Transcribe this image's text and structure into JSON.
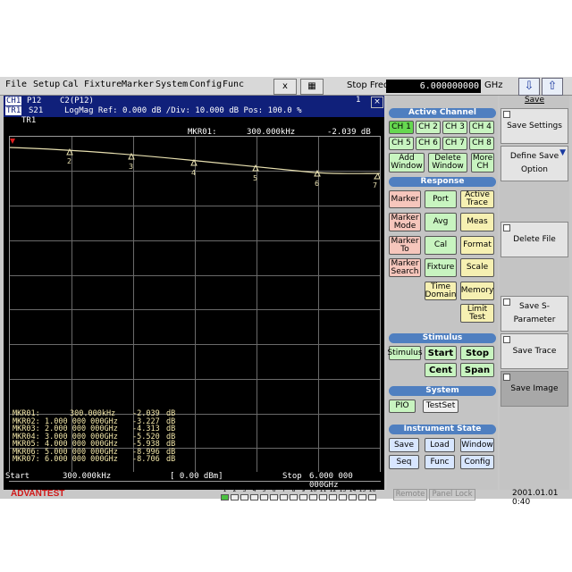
{
  "menu": [
    "File",
    "Setup",
    "Cal",
    "Fixture",
    "Marker",
    "System",
    "Config",
    "Func"
  ],
  "toolbar": {
    "x_btn": "x",
    "stop_freq_label": "Stop Freq",
    "stop_freq_value": "6.000000000",
    "stop_freq_unit": "GHz"
  },
  "screen": {
    "ch_label": "CH1",
    "p12": "P12",
    "c2": "C2(P12)",
    "tr_label": "TR1",
    "s21": "S21",
    "params": "LogMag  Ref: 0.000 dB  /Div: 10.000 dB  Pos: 100.0 %",
    "trace_tab": "TR1",
    "window_num": "1",
    "close": "×",
    "active_marker_label": "MKR01:",
    "active_marker_freq": "300.000kHz",
    "active_marker_val": "-2.039 dB"
  },
  "markers": [
    {
      "label": "MKR01:",
      "freq": "300.000kHz",
      "val": "-2.039",
      "unit": "dB"
    },
    {
      "label": "MKR02:",
      "freq": "1.000 000 000GHz",
      "val": "-3.227",
      "unit": "dB"
    },
    {
      "label": "MKR03:",
      "freq": "2.000 000 000GHz",
      "val": "-4.313",
      "unit": "dB"
    },
    {
      "label": "MKR04:",
      "freq": "3.000 000 000GHz",
      "val": "-5.520",
      "unit": "dB"
    },
    {
      "label": "MKR05:",
      "freq": "4.000 000 000GHz",
      "val": "-5.938",
      "unit": "dB"
    },
    {
      "label": "MKR06:",
      "freq": "5.000 000 000GHz",
      "val": "-8.996",
      "unit": "dB"
    },
    {
      "label": "MKR07:",
      "freq": "6.000 000 000GHz",
      "val": "-8.706",
      "unit": "dB"
    }
  ],
  "marker_numbers": [
    "2",
    "3",
    "4",
    "5",
    "6",
    "7"
  ],
  "statusbar": {
    "start_label": "Start",
    "start_val": "300.000kHz",
    "power": "[ 0.00 dBm]",
    "stop_label": "Stop",
    "stop_val": "6.000 000 000GHz"
  },
  "panel": {
    "active_channel": "Active Channel",
    "channels": [
      "CH 1",
      "CH 2",
      "CH 3",
      "CH 4",
      "CH 5",
      "CH 6",
      "CH 7",
      "CH 8"
    ],
    "add_window": "Add Window",
    "delete_window": "Delete Window",
    "more_ch": "More CH",
    "response": "Response",
    "marker": "Marker",
    "port": "Port",
    "active_trace": "Active Trace",
    "marker_mode": "Marker Mode",
    "avg": "Avg",
    "meas": "Meas",
    "marker_to": "Marker To",
    "cal": "Cal",
    "format": "Format",
    "marker_search": "Marker Search",
    "fixture": "Fixture",
    "scale": "Scale",
    "time_domain": "Time Domain",
    "memory": "Memory",
    "limit_test": "Limit Test",
    "stimulus": "Stimulus",
    "stimulus_btn": "Stimulus",
    "start": "Start",
    "stop": "Stop",
    "cent": "Cent",
    "span": "Span",
    "system": "System",
    "pio": "PIO",
    "testset": "TestSet",
    "instrument_state": "Instrument State",
    "save": "Save",
    "load": "Load",
    "window": "Window",
    "seq": "Seq",
    "func": "Func",
    "config": "Config"
  },
  "softkeys": {
    "title": "Save",
    "save_settings": "Save Settings",
    "define_save_option": "Define Save Option",
    "delete_file": "Delete File",
    "save_sparam": "Save S-Parameter",
    "save_trace": "Save Trace",
    "save_image": "Save Image"
  },
  "bottom": {
    "brand": "ADVANTEST",
    "leds": [
      "1",
      "2",
      "3",
      "4",
      "5",
      "6",
      "7",
      "8",
      "9",
      "10",
      "11",
      "12",
      "13",
      "14",
      "15",
      "16"
    ],
    "remote": "Remote",
    "panel_lock": "Panel Lock",
    "clock": "2001.01.01 0:40"
  },
  "colors": {
    "trace": "#e8e0b0",
    "marker_text": "#f2e6a8",
    "title_bar": "#10207a",
    "section": "#4f7fc0",
    "brand": "#d01818"
  }
}
